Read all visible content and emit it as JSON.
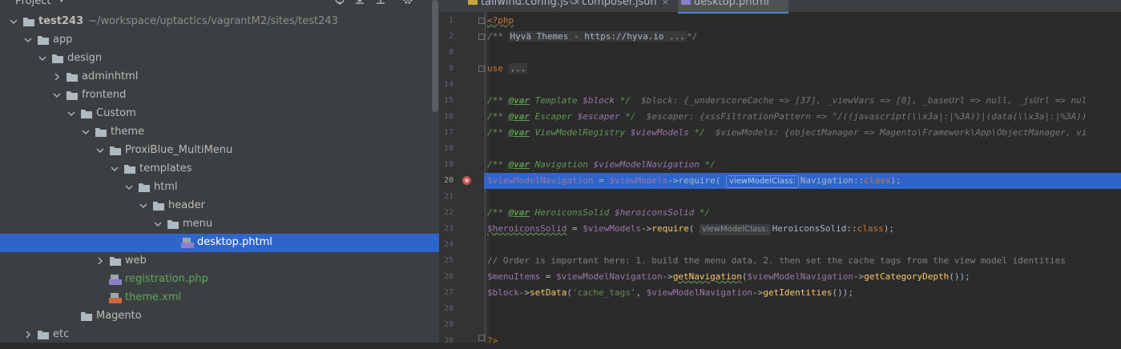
{
  "project_panel": {
    "title": "Project",
    "dropdown_glyph": "▼",
    "tree": [
      {
        "label": "test243",
        "path": "~/workspace/uptactics/vagrantM2/sites/test243",
        "arrow": "down",
        "icon": "folder",
        "level": 0,
        "bold": true
      },
      {
        "label": "app",
        "arrow": "down",
        "icon": "folder",
        "level": 1
      },
      {
        "label": "design",
        "arrow": "down",
        "icon": "folder",
        "level": 2
      },
      {
        "label": "adminhtml",
        "arrow": "right",
        "icon": "folder",
        "level": 3
      },
      {
        "label": "frontend",
        "arrow": "down",
        "icon": "folder",
        "level": 3
      },
      {
        "label": "Custom",
        "arrow": "down",
        "icon": "folder",
        "level": 4
      },
      {
        "label": "theme",
        "arrow": "down",
        "icon": "folder",
        "level": 5
      },
      {
        "label": "ProxiBlue_MultiMenu",
        "arrow": "down",
        "icon": "folder",
        "level": 6
      },
      {
        "label": "templates",
        "arrow": "down",
        "icon": "folder",
        "level": 7
      },
      {
        "label": "html",
        "arrow": "down",
        "icon": "folder",
        "level": 8
      },
      {
        "label": "header",
        "arrow": "down",
        "icon": "folder",
        "level": 9
      },
      {
        "label": "menu",
        "arrow": "down",
        "icon": "folder",
        "level": 10
      },
      {
        "label": "desktop.phtml",
        "arrow": "none",
        "icon": "php",
        "level": 11,
        "selected": true
      },
      {
        "label": "web",
        "arrow": "right",
        "icon": "folder",
        "level": 6
      },
      {
        "label": "registration.php",
        "arrow": "none",
        "icon": "php",
        "level": 6,
        "green": true
      },
      {
        "label": "theme.xml",
        "arrow": "none",
        "icon": "xml",
        "level": 6,
        "green": true
      },
      {
        "label": "Magento",
        "arrow": "none",
        "icon": "folder",
        "level": 4
      },
      {
        "label": "etc",
        "arrow": "right",
        "icon": "folder",
        "level": 1
      }
    ]
  },
  "tabs": [
    {
      "label": "tailwind.config.js",
      "icon": "js",
      "close": "×"
    },
    {
      "label": "composer.json",
      "icon": "gear",
      "close": "×"
    },
    {
      "label": "desktop.phtml",
      "icon": "php",
      "close": "",
      "active": true
    }
  ],
  "editor": {
    "line_numbers": [
      "1",
      "2",
      "8",
      "9",
      "14",
      "15",
      "16",
      "17",
      "18",
      "19",
      "20",
      "21",
      "22",
      "23",
      "24",
      "25",
      "26",
      "27",
      "28",
      "29",
      "30"
    ],
    "current_line": "20",
    "lines": {
      "l1": "<?php",
      "l2_prefix": "/** ",
      "l2_fold": "Hyvä Themes - https://hyva.io ...",
      "l2_suffix": "*/",
      "l9_kw": "use",
      "l9_fold": "...",
      "var_tag": "@var",
      "l15_type": "Template",
      "l15_var": "$block",
      "l15_hint": "$block: {_underscoreCache => [37], _viewVars => [0], _baseUrl => null, _jsUrl => nul",
      "l16_type": "Escaper",
      "l16_var": "$escaper",
      "l16_hint": "$escaper: {xssFiltrationPattern => \"/((javascript(\\\\x3a|:|%3A))|(data(\\\\x3a|:|%3A))",
      "l17_type": "ViewModelRegistry",
      "l17_var": "$viewModels",
      "l17_hint": "$viewModels: {objectManager => Magento\\Framework\\App\\ObjectManager, vi",
      "l19_type": "Navigation",
      "l19_var": "$viewModelNavigation",
      "l20_var": "$viewModelNavigation",
      "l20_var2": "$viewModels",
      "l20_fn": "require",
      "inlay": "viewModelClass:",
      "l20_cls": "Navigation",
      "class_kw": "class",
      "l22_type": "HeroiconsSolid",
      "l22_var": "$heroiconsSolid",
      "l23_var": "$heroiconsSolid",
      "l23_cls": "HeroiconsSolid",
      "l25_comment": "// Order is important here: 1. build the menu data, 2. then set the cache tags from the view model identities",
      "l26_var": "$menuItems",
      "l26_fn1": "getNavigation",
      "l26_fn2": "getCategoryDepth",
      "l27_var": "$block",
      "l27_fn": "setData",
      "l27_str": "'cache_tags'",
      "l27_fn2": "getIdentities",
      "l30": "?>"
    }
  },
  "colors": {
    "selection": "#2f65ca",
    "panel_bg": "#3c3f41",
    "editor_bg": "#2b2b2b",
    "green_file": "#62a85e"
  }
}
